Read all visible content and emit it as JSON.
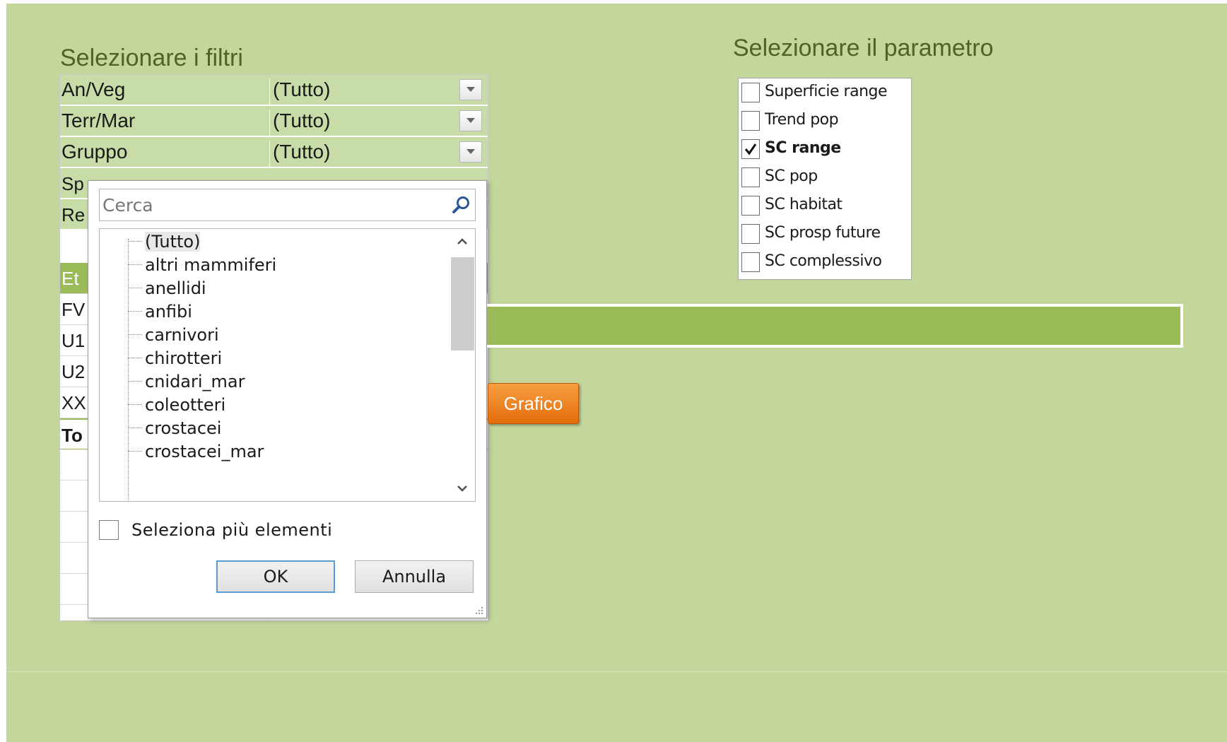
{
  "filters_section": {
    "title": "Selezionare i filtri",
    "rows": [
      {
        "label": "An/Veg",
        "value": "(Tutto)"
      },
      {
        "label": "Terr/Mar",
        "value": "(Tutto)"
      },
      {
        "label": "Gruppo",
        "value": "(Tutto)"
      }
    ],
    "hidden_row_prefixes": [
      "Sp",
      "Re",
      "Et",
      "FV",
      "U1",
      "U2",
      "XX",
      "To"
    ]
  },
  "filter_popup": {
    "search_placeholder": "Cerca",
    "items": [
      "(Tutto)",
      "altri mammiferi",
      "anellidi",
      "anfibi",
      "carnivori",
      "chirotteri",
      "cnidari_mar",
      "coleotteri",
      "crostacei",
      "crostacei_mar"
    ],
    "selected_item": "(Tutto)",
    "multi_select_label": "Seleziona più elementi",
    "multi_select_checked": false,
    "ok_label": "OK",
    "cancel_label": "Annulla"
  },
  "parameter_section": {
    "title": "Selezionare il parametro",
    "items": [
      {
        "label": "Superficie range",
        "checked": false
      },
      {
        "label": "Trend pop",
        "checked": false
      },
      {
        "label": "SC range",
        "checked": true
      },
      {
        "label": "SC pop",
        "checked": false
      },
      {
        "label": "SC habitat",
        "checked": false
      },
      {
        "label": "SC prosp future",
        "checked": false
      },
      {
        "label": "SC complessivo",
        "checked": false
      }
    ]
  },
  "chart_button": {
    "label": "Grafico"
  },
  "colors": {
    "background": "#c3d69b",
    "title_text": "#4f6228",
    "band": "#9bbb59",
    "button": "#e36c0a"
  }
}
